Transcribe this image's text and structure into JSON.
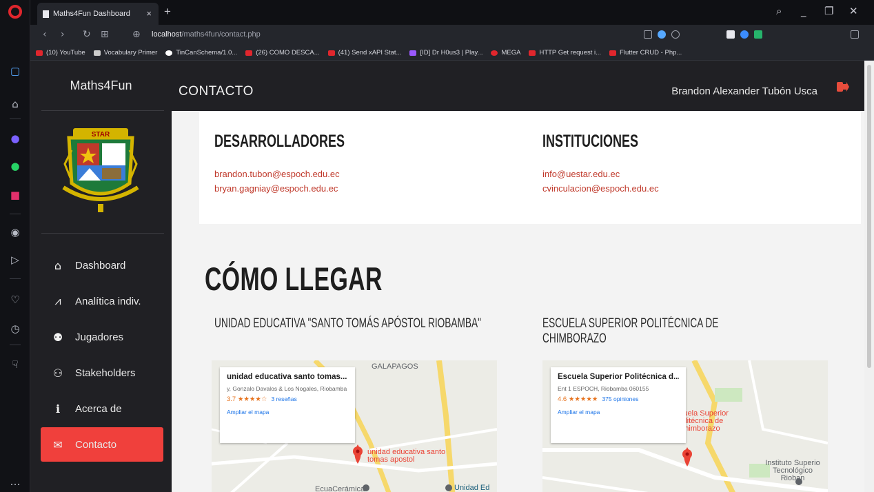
{
  "browser": {
    "tab_title": "Maths4Fun Dashboard",
    "tab_close": "×",
    "new_tab": "+",
    "url_host": "localhost",
    "url_path": "/maths4fun/contact.php",
    "bookmarks": [
      {
        "label": "(10) YouTube",
        "color": "#e0262d"
      },
      {
        "label": "Vocabulary Primer",
        "color": "#ffffff"
      },
      {
        "label": "TinCanSchema/1.0...",
        "color": "#ffffff"
      },
      {
        "label": "(26) COMO DESCA...",
        "color": "#e0262d"
      },
      {
        "label": "(41) Send xAPI Stat...",
        "color": "#e0262d"
      },
      {
        "label": "[ID] Dr H0us3 | Play...",
        "color": "#e0262d"
      },
      {
        "label": "MEGA",
        "color": "#e0262d"
      },
      {
        "label": "HTTP Get request i...",
        "color": "#e0262d"
      },
      {
        "label": "Flutter CRUD - Php...",
        "color": "#e0262d"
      }
    ]
  },
  "sidebar": {
    "brand": "Maths4Fun",
    "crest_text": "STAR",
    "items": [
      {
        "label": "Dashboard",
        "icon": "home-icon",
        "glyph": "⌂"
      },
      {
        "label": "Analítica indiv.",
        "icon": "chart-line-icon",
        "glyph": "📈"
      },
      {
        "label": "Jugadores",
        "icon": "users-icon",
        "glyph": "👥"
      },
      {
        "label": "Stakeholders",
        "icon": "user-friends-icon",
        "glyph": "👤"
      },
      {
        "label": "Acerca de",
        "icon": "info-icon",
        "glyph": "ℹ"
      },
      {
        "label": "Contacto",
        "icon": "envelope-icon",
        "glyph": "✉"
      }
    ],
    "active_item": "Contacto"
  },
  "header": {
    "title": "CONTACTO",
    "user_name": "Brandon Alexander Tubón Usca"
  },
  "contact": {
    "developers_heading": "DESARROLLADORES",
    "developers": [
      "brandon.tubon@espoch.edu.ec",
      "bryan.gagniay@espoch.edu.ec"
    ],
    "institutions_heading": "INSTITUCIONES",
    "institutions": [
      "info@uestar.edu.ec",
      "cvinculacion@espoch.edu.ec"
    ]
  },
  "directions": {
    "heading": "CÓMO LLEGAR",
    "left_title": "UNIDAD EDUCATIVA \"SANTO TOMÁS APÓSTOL RIOBAMBA\"",
    "right_title": "ESCUELA SUPERIOR POLITÉCNICA DE CHIMBORAZO",
    "map1": {
      "place": "unidad educativa santo tomas...",
      "address": "y, Gonzalo Davalos & Los Nogales, Riobamba",
      "rating": "3.7 ★★★★☆",
      "reviews": "3 reseñas",
      "link": "Ampliar el mapa",
      "top_label": "GALAPAGOS",
      "pin_label": "unidad educativa santo tomas apostol",
      "bottom_left": "EcuaCerámica",
      "bottom_right": "Unidad Ed"
    },
    "map2": {
      "place": "Escuela Superior Politécnica d...",
      "address": "Ent 1 ESPOCH, Riobamba 060155",
      "rating": "4.6 ★★★★★",
      "reviews": "375 opiniones",
      "link": "Ampliar el mapa",
      "pin_label": "Escuela Superior Politécnica de Chimborazo",
      "right_label": "Instituto Superio Tecnológico Rioban"
    }
  }
}
